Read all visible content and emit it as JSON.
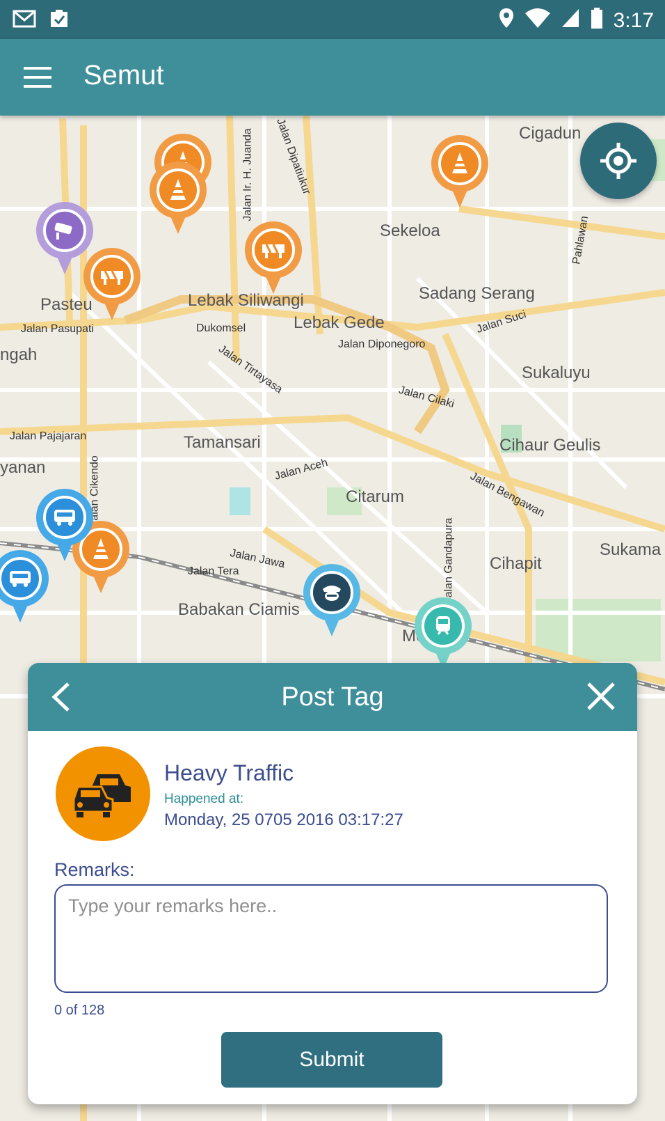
{
  "status_bar": {
    "time": "3:17",
    "left_icons": [
      "mail-icon",
      "clipboard-check-icon"
    ],
    "right_icons": [
      "location-icon",
      "wifi-icon",
      "signal-icon",
      "battery-icon"
    ]
  },
  "app_bar": {
    "title": "Semut"
  },
  "map": {
    "labels": [
      {
        "text": "Cigadun"
      },
      {
        "text": "Sekeloa"
      },
      {
        "text": "Sadang Serang"
      },
      {
        "text": "Lebak Siliwangi"
      },
      {
        "text": "Lebak Gede"
      },
      {
        "text": "Dukomsel"
      },
      {
        "text": "Pasteu"
      },
      {
        "text": "Sukaluyu"
      },
      {
        "text": "Tamansari"
      },
      {
        "text": "Cihaur Geulis"
      },
      {
        "text": "Citarum"
      },
      {
        "text": "Cihapit"
      },
      {
        "text": "Babakan Ciamis"
      },
      {
        "text": "Sukama"
      },
      {
        "text": "Jalan Pasupati"
      },
      {
        "text": "Jalan Pajajaran"
      },
      {
        "text": "Jalan Diponegoro"
      },
      {
        "text": "Jalan Tirtayasa"
      },
      {
        "text": "Jalan Cilaki"
      },
      {
        "text": "Jalan Aceh"
      },
      {
        "text": "Jalan Bengawan"
      },
      {
        "text": "Jalan Jawa"
      },
      {
        "text": "Jalan Tera"
      },
      {
        "text": "Jalan Suci"
      },
      {
        "text": "Jalan Cikendo"
      },
      {
        "text": "Jalan Ir. H. Juanda"
      },
      {
        "text": "Jalan Dipatiukur"
      },
      {
        "text": "Jalan Gandapura"
      },
      {
        "text": "Pahlawan"
      },
      {
        "text": "Merdeka"
      },
      {
        "text": "yanan"
      },
      {
        "text": "ngah"
      }
    ],
    "markers": [
      {
        "type": "roadwork-cone"
      },
      {
        "type": "roadwork-cone"
      },
      {
        "type": "roadwork-cone"
      },
      {
        "type": "roadblock"
      },
      {
        "type": "roadblock"
      },
      {
        "type": "cctv"
      },
      {
        "type": "roadwork-cone"
      },
      {
        "type": "bus"
      },
      {
        "type": "bus"
      },
      {
        "type": "train"
      },
      {
        "type": "police"
      }
    ]
  },
  "dialog": {
    "title": "Post Tag",
    "event": {
      "name": "Heavy Traffic",
      "happened_label": "Happened at:",
      "happened_value": "Monday, 25 0705 2016 03:17:27"
    },
    "remarks_label": "Remarks:",
    "remarks_placeholder": "Type your remarks here..",
    "remarks_value": "",
    "counter": "0 of 128",
    "submit_label": "Submit"
  },
  "colors": {
    "primary": "#3f8f9a",
    "primary_dark": "#2e6b79",
    "event_orange": "#f39200",
    "text_navy": "#3c4d8f"
  }
}
